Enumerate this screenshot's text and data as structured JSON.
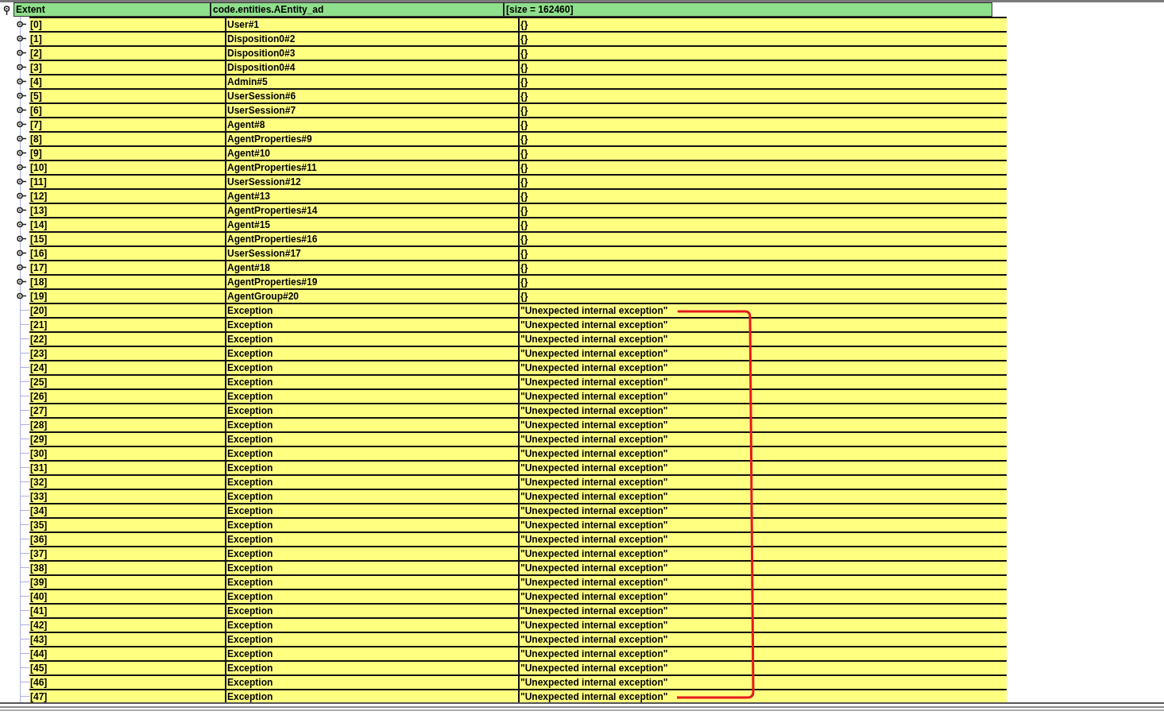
{
  "root": {
    "expanded": true,
    "label": "Extent",
    "type": "code.entities.AEntity_ad",
    "value": "[size = 162460]"
  },
  "rows": [
    {
      "index": "[0]",
      "name": "User#1",
      "value": "{}",
      "expandable": true
    },
    {
      "index": "[1]",
      "name": "Disposition0#2",
      "value": "{}",
      "expandable": true
    },
    {
      "index": "[2]",
      "name": "Disposition0#3",
      "value": "{}",
      "expandable": true
    },
    {
      "index": "[3]",
      "name": "Disposition0#4",
      "value": "{}",
      "expandable": true
    },
    {
      "index": "[4]",
      "name": "Admin#5",
      "value": "{}",
      "expandable": true
    },
    {
      "index": "[5]",
      "name": "UserSession#6",
      "value": "{}",
      "expandable": true
    },
    {
      "index": "[6]",
      "name": "UserSession#7",
      "value": "{}",
      "expandable": true
    },
    {
      "index": "[7]",
      "name": "Agent#8",
      "value": "{}",
      "expandable": true
    },
    {
      "index": "[8]",
      "name": "AgentProperties#9",
      "value": "{}",
      "expandable": true
    },
    {
      "index": "[9]",
      "name": "Agent#10",
      "value": "{}",
      "expandable": true
    },
    {
      "index": "[10]",
      "name": "AgentProperties#11",
      "value": "{}",
      "expandable": true
    },
    {
      "index": "[11]",
      "name": "UserSession#12",
      "value": "{}",
      "expandable": true
    },
    {
      "index": "[12]",
      "name": "Agent#13",
      "value": "{}",
      "expandable": true
    },
    {
      "index": "[13]",
      "name": "AgentProperties#14",
      "value": "{}",
      "expandable": true
    },
    {
      "index": "[14]",
      "name": "Agent#15",
      "value": "{}",
      "expandable": true
    },
    {
      "index": "[15]",
      "name": "AgentProperties#16",
      "value": "{}",
      "expandable": true
    },
    {
      "index": "[16]",
      "name": "UserSession#17",
      "value": "{}",
      "expandable": true
    },
    {
      "index": "[17]",
      "name": "Agent#18",
      "value": "{}",
      "expandable": true
    },
    {
      "index": "[18]",
      "name": "AgentProperties#19",
      "value": "{}",
      "expandable": true
    },
    {
      "index": "[19]",
      "name": "AgentGroup#20",
      "value": "{}",
      "expandable": true
    },
    {
      "index": "[20]",
      "name": "Exception",
      "value": "\"Unexpected internal exception\"",
      "expandable": false
    },
    {
      "index": "[21]",
      "name": "Exception",
      "value": "\"Unexpected internal exception\"",
      "expandable": false
    },
    {
      "index": "[22]",
      "name": "Exception",
      "value": "\"Unexpected internal exception\"",
      "expandable": false
    },
    {
      "index": "[23]",
      "name": "Exception",
      "value": "\"Unexpected internal exception\"",
      "expandable": false
    },
    {
      "index": "[24]",
      "name": "Exception",
      "value": "\"Unexpected internal exception\"",
      "expandable": false
    },
    {
      "index": "[25]",
      "name": "Exception",
      "value": "\"Unexpected internal exception\"",
      "expandable": false
    },
    {
      "index": "[26]",
      "name": "Exception",
      "value": "\"Unexpected internal exception\"",
      "expandable": false
    },
    {
      "index": "[27]",
      "name": "Exception",
      "value": "\"Unexpected internal exception\"",
      "expandable": false
    },
    {
      "index": "[28]",
      "name": "Exception",
      "value": "\"Unexpected internal exception\"",
      "expandable": false
    },
    {
      "index": "[29]",
      "name": "Exception",
      "value": "\"Unexpected internal exception\"",
      "expandable": false
    },
    {
      "index": "[30]",
      "name": "Exception",
      "value": "\"Unexpected internal exception\"",
      "expandable": false
    },
    {
      "index": "[31]",
      "name": "Exception",
      "value": "\"Unexpected internal exception\"",
      "expandable": false
    },
    {
      "index": "[32]",
      "name": "Exception",
      "value": "\"Unexpected internal exception\"",
      "expandable": false
    },
    {
      "index": "[33]",
      "name": "Exception",
      "value": "\"Unexpected internal exception\"",
      "expandable": false
    },
    {
      "index": "[34]",
      "name": "Exception",
      "value": "\"Unexpected internal exception\"",
      "expandable": false
    },
    {
      "index": "[35]",
      "name": "Exception",
      "value": "\"Unexpected internal exception\"",
      "expandable": false
    },
    {
      "index": "[36]",
      "name": "Exception",
      "value": "\"Unexpected internal exception\"",
      "expandable": false
    },
    {
      "index": "[37]",
      "name": "Exception",
      "value": "\"Unexpected internal exception\"",
      "expandable": false
    },
    {
      "index": "[38]",
      "name": "Exception",
      "value": "\"Unexpected internal exception\"",
      "expandable": false
    },
    {
      "index": "[39]",
      "name": "Exception",
      "value": "\"Unexpected internal exception\"",
      "expandable": false
    },
    {
      "index": "[40]",
      "name": "Exception",
      "value": "\"Unexpected internal exception\"",
      "expandable": false
    },
    {
      "index": "[41]",
      "name": "Exception",
      "value": "\"Unexpected internal exception\"",
      "expandable": false
    },
    {
      "index": "[42]",
      "name": "Exception",
      "value": "\"Unexpected internal exception\"",
      "expandable": false
    },
    {
      "index": "[43]",
      "name": "Exception",
      "value": "\"Unexpected internal exception\"",
      "expandable": false
    },
    {
      "index": "[44]",
      "name": "Exception",
      "value": "\"Unexpected internal exception\"",
      "expandable": false
    },
    {
      "index": "[45]",
      "name": "Exception",
      "value": "\"Unexpected internal exception\"",
      "expandable": false
    },
    {
      "index": "[46]",
      "name": "Exception",
      "value": "\"Unexpected internal exception\"",
      "expandable": false
    },
    {
      "index": "[47]",
      "name": "Exception",
      "value": "\"Unexpected internal exception\"",
      "expandable": false
    }
  ]
}
